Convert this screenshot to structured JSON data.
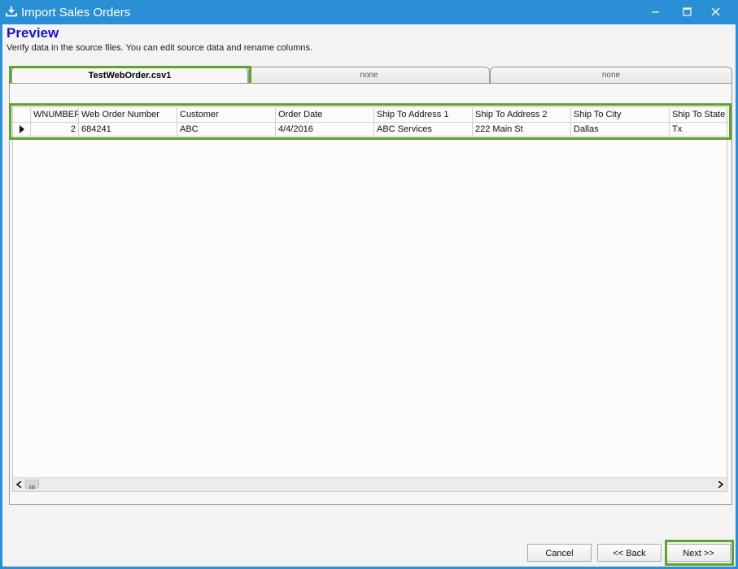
{
  "window": {
    "title": "Import Sales Orders",
    "icon": "download-icon",
    "controls": [
      "minimize-icon",
      "maximize-icon",
      "close-icon"
    ]
  },
  "page": {
    "title": "Preview",
    "subtitle": "Verify data in the source files. You can edit source data and rename columns."
  },
  "tabs": [
    {
      "label": "TestWebOrder.csv1",
      "active": true
    },
    {
      "label": "none",
      "active": false
    },
    {
      "label": "none",
      "active": false
    }
  ],
  "grid": {
    "columns": [
      "WNUMBER",
      "Web Order Number",
      "Customer",
      "Order Date",
      "Ship To Address 1",
      "Ship To Address 2",
      "Ship To City",
      "Ship To State"
    ],
    "rows": [
      [
        "2",
        "684241",
        "ABC",
        "4/4/2016",
        "ABC Services",
        "222 Main St",
        "Dallas",
        "Tx"
      ]
    ]
  },
  "buttons": {
    "cancel": "Cancel",
    "back": "<< Back",
    "next": "Next >>"
  },
  "colors": {
    "titlebar": "#2b8fd6",
    "title_text": "#1a12c8",
    "highlight": "#5fa22e"
  }
}
